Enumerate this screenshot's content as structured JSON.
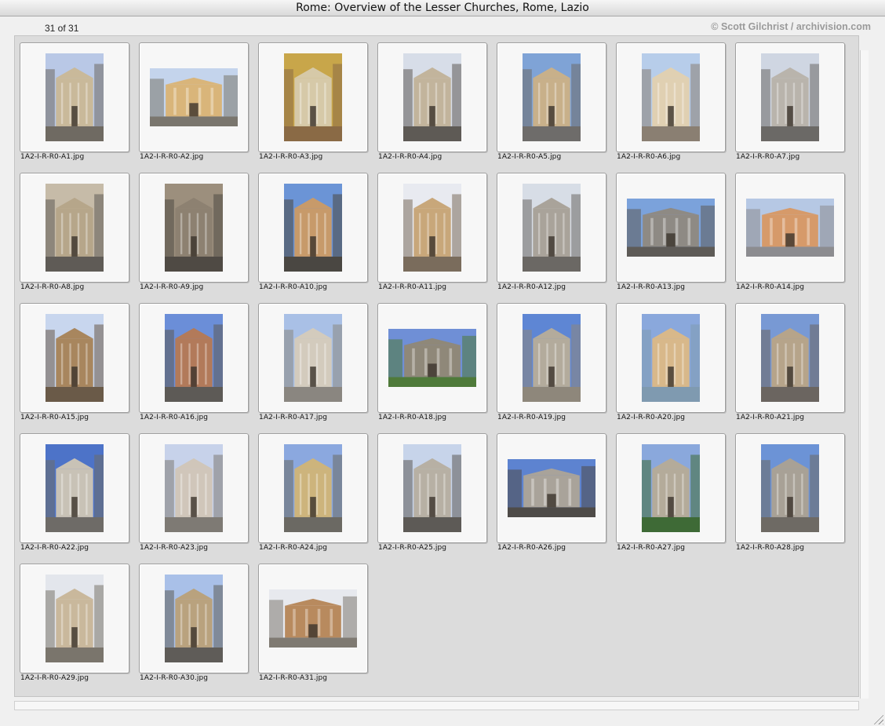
{
  "window": {
    "title": "Rome: Overview of the Lesser Churches, Rome, Lazio",
    "counter": "31 of 31",
    "copyright": "© Scott Gilchrist / archivision.com"
  },
  "colors": {
    "panel_bg": "#dcdcdc",
    "card_bg": "#f7f7f7",
    "sky_blue": "#8fa9d6",
    "stone": "#b8a88a"
  },
  "thumbnails": [
    {
      "filename": "1A2-I-R-R0-A1.jpg",
      "orientation": "portrait",
      "sky": "#b9c8e6",
      "stone": "#c9b99a",
      "ground": "#6f6a62"
    },
    {
      "filename": "1A2-I-R-R0-A2.jpg",
      "orientation": "landscape",
      "sky": "#c4d4ec",
      "stone": "#d9b57a",
      "ground": "#7a766e"
    },
    {
      "filename": "1A2-I-R-R0-A3.jpg",
      "orientation": "portrait",
      "sky": "#c8a64a",
      "stone": "#d6c9a8",
      "ground": "#8a6a45"
    },
    {
      "filename": "1A2-I-R-R0-A4.jpg",
      "orientation": "portrait",
      "sky": "#d7dde8",
      "stone": "#c2b49c",
      "ground": "#5e5a55"
    },
    {
      "filename": "1A2-I-R-R0-A5.jpg",
      "orientation": "portrait",
      "sky": "#7fa3d6",
      "stone": "#c8b08a",
      "ground": "#6e6c6a"
    },
    {
      "filename": "1A2-I-R-R0-A6.jpg",
      "orientation": "portrait",
      "sky": "#b7cdea",
      "stone": "#e0d0b2",
      "ground": "#8a7f72"
    },
    {
      "filename": "1A2-I-R-R0-A7.jpg",
      "orientation": "portrait",
      "sky": "#cfd6e2",
      "stone": "#b9b4ac",
      "ground": "#6b6966"
    },
    {
      "filename": "1A2-I-R-R0-A8.jpg",
      "orientation": "portrait",
      "sky": "#c6bba8",
      "stone": "#b6a68a",
      "ground": "#5f5b56"
    },
    {
      "filename": "1A2-I-R-R0-A9.jpg",
      "orientation": "portrait",
      "sky": "#9c8f7d",
      "stone": "#8d8171",
      "ground": "#4f4a44"
    },
    {
      "filename": "1A2-I-R-R0-A10.jpg",
      "orientation": "portrait",
      "sky": "#6b94d6",
      "stone": "#c79a6a",
      "ground": "#4a4742"
    },
    {
      "filename": "1A2-I-R-R0-A11.jpg",
      "orientation": "portrait",
      "sky": "#e8eaf0",
      "stone": "#c8a77a",
      "ground": "#7a6c5c"
    },
    {
      "filename": "1A2-I-R-R0-A12.jpg",
      "orientation": "portrait",
      "sky": "#d7dde6",
      "stone": "#a9a39a",
      "ground": "#6b6864"
    },
    {
      "filename": "1A2-I-R-R0-A13.jpg",
      "orientation": "landscape",
      "sky": "#7ba2db",
      "stone": "#8e8a84",
      "ground": "#5e5b57"
    },
    {
      "filename": "1A2-I-R-R0-A14.jpg",
      "orientation": "landscape",
      "sky": "#b6c8e4",
      "stone": "#d69a6a",
      "ground": "#8c8c90"
    },
    {
      "filename": "1A2-I-R-R0-A15.jpg",
      "orientation": "portrait",
      "sky": "#c8d6ee",
      "stone": "#a8865e",
      "ground": "#6a5a48"
    },
    {
      "filename": "1A2-I-R-R0-A16.jpg",
      "orientation": "portrait",
      "sky": "#6b8ed8",
      "stone": "#b27a5a",
      "ground": "#5d5a56"
    },
    {
      "filename": "1A2-I-R-R0-A17.jpg",
      "orientation": "portrait",
      "sky": "#a9c0e6",
      "stone": "#d3cbbd",
      "ground": "#8a8680"
    },
    {
      "filename": "1A2-I-R-R0-A18.jpg",
      "orientation": "landscape",
      "sky": "#6f8fd6",
      "stone": "#8f8879",
      "ground": "#4f7a3a"
    },
    {
      "filename": "1A2-I-R-R0-A19.jpg",
      "orientation": "portrait",
      "sky": "#5e86d4",
      "stone": "#b3ab9c",
      "ground": "#8e877b"
    },
    {
      "filename": "1A2-I-R-R0-A20.jpg",
      "orientation": "portrait",
      "sky": "#8aa8dc",
      "stone": "#d8b88a",
      "ground": "#7f9ab0"
    },
    {
      "filename": "1A2-I-R-R0-A21.jpg",
      "orientation": "portrait",
      "sky": "#7899d4",
      "stone": "#b6a48a",
      "ground": "#6b6560"
    },
    {
      "filename": "1A2-I-R-R0-A22.jpg",
      "orientation": "portrait",
      "sky": "#4d73c8",
      "stone": "#c8c2b6",
      "ground": "#6e6b67"
    },
    {
      "filename": "1A2-I-R-R0-A23.jpg",
      "orientation": "portrait",
      "sky": "#c7d2ea",
      "stone": "#d0c6ba",
      "ground": "#7e7a74"
    },
    {
      "filename": "1A2-I-R-R0-A24.jpg",
      "orientation": "portrait",
      "sky": "#8ba8df",
      "stone": "#cdb47c",
      "ground": "#6b6963"
    },
    {
      "filename": "1A2-I-R-R0-A25.jpg",
      "orientation": "portrait",
      "sky": "#c7d4ea",
      "stone": "#b7b0a4",
      "ground": "#5d5a56"
    },
    {
      "filename": "1A2-I-R-R0-A26.jpg",
      "orientation": "landscape",
      "sky": "#5d83d0",
      "stone": "#a9a39a",
      "ground": "#4e4b48"
    },
    {
      "filename": "1A2-I-R-R0-A27.jpg",
      "orientation": "portrait",
      "sky": "#8aa8dc",
      "stone": "#b4ab9a",
      "ground": "#3e6a36"
    },
    {
      "filename": "1A2-I-R-R0-A28.jpg",
      "orientation": "portrait",
      "sky": "#6c93d6",
      "stone": "#a8a196",
      "ground": "#6e6a64"
    },
    {
      "filename": "1A2-I-R-R0-A29.jpg",
      "orientation": "portrait",
      "sky": "#e3e6ec",
      "stone": "#c9b89c",
      "ground": "#7a756c"
    },
    {
      "filename": "1A2-I-R-R0-A30.jpg",
      "orientation": "portrait",
      "sky": "#a9c0e8",
      "stone": "#b9a27e",
      "ground": "#5f5c58"
    },
    {
      "filename": "1A2-I-R-R0-A31.jpg",
      "orientation": "landscape",
      "sky": "#e7e9ee",
      "stone": "#b88a5e",
      "ground": "#7f7a72"
    }
  ]
}
